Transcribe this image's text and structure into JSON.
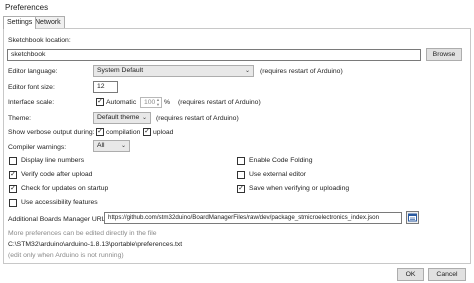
{
  "window": {
    "title": "Preferences"
  },
  "tabs": [
    {
      "label": "Settings"
    },
    {
      "label": "Network"
    }
  ],
  "sketchbook": {
    "label": "Sketchbook location:",
    "value": "sketchbook",
    "browse_label": "Browse"
  },
  "editor_language": {
    "label": "Editor language:",
    "value": "System Default",
    "note": "(requires restart of Arduino)"
  },
  "editor_font_size": {
    "label": "Editor font size:",
    "value": "12"
  },
  "interface_scale": {
    "label": "Interface scale:",
    "automatic_label": "Automatic",
    "value": "100",
    "unit": "%",
    "note": "(requires restart of Arduino)"
  },
  "theme": {
    "label": "Theme:",
    "value": "Default theme",
    "note": "(requires restart of Arduino)"
  },
  "verbose": {
    "label": "Show verbose output during:",
    "compilation_label": "compilation",
    "upload_label": "upload"
  },
  "compiler_warnings": {
    "label": "Compiler warnings:",
    "value": "All"
  },
  "options_left": [
    {
      "label": "Display line numbers",
      "checked": false
    },
    {
      "label": "Verify code after upload",
      "checked": true
    },
    {
      "label": "Check for updates on startup",
      "checked": true
    },
    {
      "label": "Use accessibility features",
      "checked": false
    }
  ],
  "options_right": [
    {
      "label": "Enable Code Folding",
      "checked": false
    },
    {
      "label": "Use external editor",
      "checked": false
    },
    {
      "label": "Save when verifying or uploading",
      "checked": true
    }
  ],
  "boards_manager": {
    "label": "Additional Boards Manager URLs:",
    "value": "https://github.com/stm32duino/BoardManagerFiles/raw/dev/package_stmicroelectronics_index.json"
  },
  "footer": {
    "more_prefs": "More preferences can be edited directly in the file",
    "path": "C:\\STM32\\arduino\\arduino-1.8.13\\portable\\preferences.txt",
    "note": "(edit only when Arduino is not running)"
  },
  "buttons": {
    "ok": "OK",
    "cancel": "Cancel"
  },
  "icons": {
    "folder_button": "open-list-icon",
    "checkmark": "✓",
    "dropdown": "chevron-down-icon"
  }
}
